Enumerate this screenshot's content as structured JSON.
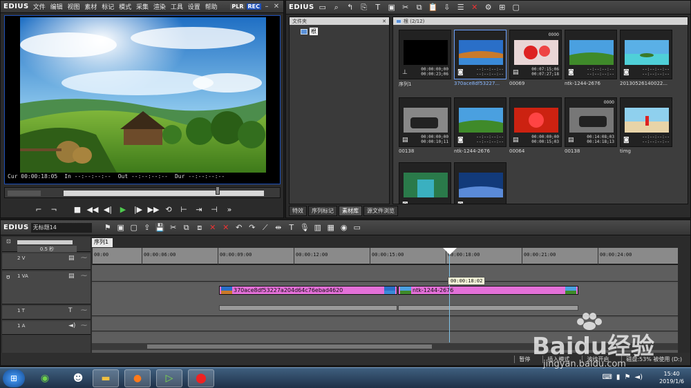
{
  "player": {
    "brand": "EDIUS",
    "menu": [
      "文件",
      "编辑",
      "视图",
      "素材",
      "标记",
      "模式",
      "采集",
      "渲染",
      "工具",
      "设置",
      "帮助"
    ],
    "plr": "PLR",
    "rec": "REC",
    "cur": "Cur 00:00:18:05",
    "in": "In --:--:--:--",
    "out": "Out --:--:--:--",
    "dur": "Dur --:--:--:--"
  },
  "bin": {
    "brand": "EDIUS",
    "folder_header": "文件夹",
    "root_label": "根",
    "clips_header": "根 (2/12)",
    "clips": [
      {
        "name": "序列1",
        "tc1": "00:00:00;00",
        "tc2": "00:00:23;06",
        "count": ""
      },
      {
        "name": "370ace8df53227...",
        "tc1": "--:--:--:--",
        "tc2": "--:--:--:--",
        "count": ""
      },
      {
        "name": "00069",
        "tc1": "00:07:15;06",
        "tc2": "00:07:27;18",
        "count": "0000"
      },
      {
        "name": "ntk-1244-2676",
        "tc1": "--:--:--:--",
        "tc2": "--:--:--:--",
        "count": ""
      },
      {
        "name": "20130526140022...",
        "tc1": "--:--:--:--",
        "tc2": "--:--:--:--",
        "count": ""
      },
      {
        "name": "00138",
        "tc1": "00:00:00;00",
        "tc2": "00:00:10;11",
        "count": ""
      },
      {
        "name": "ntk-1244-2676",
        "tc1": "--:--:--:--",
        "tc2": "--:--:--:--",
        "count": ""
      },
      {
        "name": "00064",
        "tc1": "00:00:00;00",
        "tc2": "00:00:15;03",
        "count": ""
      },
      {
        "name": "00138",
        "tc1": "00:14:08;03",
        "tc2": "00:14:18;13",
        "count": "0000"
      },
      {
        "name": "timg",
        "tc1": "--:--:--:--",
        "tc2": "--:--:--:--",
        "count": ""
      },
      {
        "name": "",
        "tc1": "",
        "tc2": "",
        "count": ""
      },
      {
        "name": "",
        "tc1": "",
        "tc2": "",
        "count": ""
      }
    ],
    "tabs": [
      "特效",
      "序列标记",
      "素材库",
      "源文件浏览"
    ]
  },
  "timeline": {
    "brand": "EDIUS",
    "project": "无标题14",
    "sequence_tab": "序列1",
    "zoom": "0.5 秒",
    "ticks": [
      "00:00",
      "00:00:06:00",
      "00:00:09:00",
      "00:00:12:00",
      "00:00:15:00",
      "00:00:18:00",
      "00:00:21:00",
      "00:00:24:00"
    ],
    "tracks": {
      "v2": "2 V",
      "va1": "1 VA",
      "t1": "1 T",
      "a1": "1 A"
    },
    "clip_a": "370ace8df53227a204d64c76ebad4620",
    "clip_b": "ntk-1244-2676",
    "tooltip": "00:00:18:02"
  },
  "status": {
    "pause": "暂停",
    "insert_mode": "插入模式",
    "ripple": "波纹开启",
    "disk": "磁盘:53% 被使用 (D:)"
  },
  "taskbar": {
    "time": "15:40",
    "date": "2019/1/6"
  },
  "watermark": {
    "text": "Baidu经验",
    "url": "jingyan.baidu.com"
  }
}
